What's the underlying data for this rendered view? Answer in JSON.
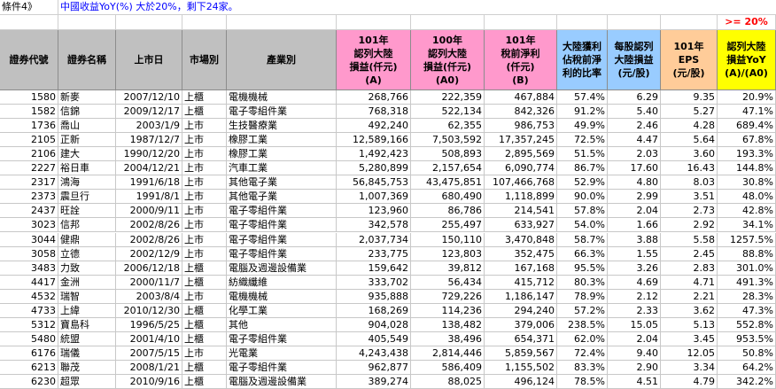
{
  "condition_label": "條件4》",
  "condition_text": "中國收益YoY(%) 大於20%，剩下24家。",
  "threshold": ">= 20%",
  "colors": {
    "header_gray": "#c0c0c0",
    "header_pink": "#ff99cc",
    "header_blue": "#99ccff",
    "header_orange": "#ffcc99",
    "header_yellow": "#ffff00",
    "title_blue": "#0000ff",
    "threshold_red": "#ff0000"
  },
  "headers": [
    {
      "lines": [
        "證券代號"
      ]
    },
    {
      "lines": [
        "證券名稱"
      ]
    },
    {
      "lines": [
        "上市日"
      ]
    },
    {
      "lines": [
        "市場別"
      ]
    },
    {
      "lines": [
        "產業別"
      ]
    },
    {
      "lines": [
        "101年",
        "認列大陸",
        "損益(仟元)",
        "(A)"
      ]
    },
    {
      "lines": [
        "100年",
        "認列大陸",
        "損益(仟元)",
        "(A0)"
      ]
    },
    {
      "lines": [
        "101年",
        "稅前淨利",
        "(仟元)",
        "(B)"
      ]
    },
    {
      "lines": [
        "大陸獲利",
        "佔稅前淨",
        "利的比率"
      ]
    },
    {
      "lines": [
        "每股認列",
        "大陸損益",
        "(元/股)"
      ]
    },
    {
      "lines": [
        "101年",
        "EPS",
        "(元/股)"
      ]
    },
    {
      "lines": [
        "認列大陸",
        "損益YoY",
        "(A)/(A0)"
      ]
    }
  ],
  "rows": [
    [
      "1580",
      "新麥",
      "2007/12/10",
      "上櫃",
      "電機機械",
      "268,766",
      "222,359",
      "467,884",
      "57.4%",
      "6.29",
      "9.35",
      "20.9%"
    ],
    [
      "1582",
      "信錦",
      "2009/12/17",
      "上櫃",
      "電子零組件業",
      "768,318",
      "522,134",
      "842,326",
      "91.2%",
      "5.40",
      "5.27",
      "47.1%"
    ],
    [
      "1736",
      "喬山",
      "2003/1/9",
      "上市",
      "生技醫療業",
      "492,240",
      "62,355",
      "986,753",
      "49.9%",
      "2.46",
      "4.28",
      "689.4%"
    ],
    [
      "2105",
      "正新",
      "1987/12/7",
      "上市",
      "橡膠工業",
      "12,589,166",
      "7,503,592",
      "17,357,245",
      "72.5%",
      "4.47",
      "5.64",
      "67.8%"
    ],
    [
      "2106",
      "建大",
      "1990/12/20",
      "上市",
      "橡膠工業",
      "1,492,423",
      "508,893",
      "2,895,569",
      "51.5%",
      "2.03",
      "3.60",
      "193.3%"
    ],
    [
      "2227",
      "裕日車",
      "2004/12/21",
      "上市",
      "汽車工業",
      "5,280,899",
      "2,157,654",
      "6,090,774",
      "86.7%",
      "17.60",
      "16.43",
      "144.8%"
    ],
    [
      "2317",
      "鴻海",
      "1991/6/18",
      "上市",
      "其他電子業",
      "56,845,753",
      "43,475,851",
      "107,466,768",
      "52.9%",
      "4.80",
      "8.03",
      "30.8%"
    ],
    [
      "2373",
      "震旦行",
      "1991/8/1",
      "上市",
      "其他電子業",
      "1,007,369",
      "680,490",
      "1,118,899",
      "90.0%",
      "2.99",
      "3.51",
      "48.0%"
    ],
    [
      "2437",
      "旺詮",
      "2000/9/11",
      "上市",
      "電子零組件業",
      "123,960",
      "86,786",
      "214,541",
      "57.8%",
      "2.04",
      "2.73",
      "42.8%"
    ],
    [
      "3023",
      "信邦",
      "2002/8/26",
      "上市",
      "電子零組件業",
      "342,578",
      "255,497",
      "633,927",
      "54.0%",
      "1.66",
      "2.92",
      "34.1%"
    ],
    [
      "3044",
      "健鼎",
      "2002/8/26",
      "上市",
      "電子零組件業",
      "2,037,734",
      "150,110",
      "3,470,848",
      "58.7%",
      "3.88",
      "5.58",
      "1257.5%"
    ],
    [
      "3058",
      "立德",
      "2002/12/9",
      "上市",
      "電子零組件業",
      "233,775",
      "123,803",
      "352,475",
      "66.3%",
      "1.55",
      "2.45",
      "88.8%"
    ],
    [
      "3483",
      "力致",
      "2006/12/18",
      "上櫃",
      "電腦及週邊設備業",
      "159,642",
      "39,812",
      "167,168",
      "95.5%",
      "3.26",
      "2.83",
      "301.0%"
    ],
    [
      "4417",
      "金洲",
      "2000/11/7",
      "上櫃",
      "紡織纖維",
      "333,702",
      "56,434",
      "415,712",
      "80.3%",
      "4.69",
      "4.71",
      "491.3%"
    ],
    [
      "4532",
      "瑞智",
      "2003/8/4",
      "上市",
      "電機機械",
      "935,888",
      "729,226",
      "1,186,147",
      "78.9%",
      "2.12",
      "2.21",
      "28.3%"
    ],
    [
      "4733",
      "上緯",
      "2010/12/30",
      "上櫃",
      "化學工業",
      "168,269",
      "114,236",
      "294,240",
      "57.2%",
      "2.33",
      "3.62",
      "47.3%"
    ],
    [
      "5312",
      "寶島科",
      "1996/5/25",
      "上櫃",
      "其他",
      "904,028",
      "138,482",
      "379,006",
      "238.5%",
      "15.05",
      "5.13",
      "552.8%"
    ],
    [
      "5480",
      "統盟",
      "2001/4/10",
      "上櫃",
      "電子零組件業",
      "405,549",
      "38,496",
      "654,371",
      "62.0%",
      "2.04",
      "3.45",
      "953.5%"
    ],
    [
      "6176",
      "瑞儀",
      "2007/5/15",
      "上市",
      "光電業",
      "4,243,438",
      "2,814,446",
      "5,859,567",
      "72.4%",
      "9.40",
      "12.05",
      "50.8%"
    ],
    [
      "6213",
      "聯茂",
      "2008/1/21",
      "上櫃",
      "電子零組件業",
      "962,877",
      "586,409",
      "1,155,502",
      "83.3%",
      "2.90",
      "3.34",
      "64.2%"
    ],
    [
      "6230",
      "超眾",
      "2010/9/16",
      "上櫃",
      "電腦及週邊設備業",
      "389,274",
      "88,025",
      "496,124",
      "78.5%",
      "4.51",
      "4.79",
      "342.2%"
    ]
  ]
}
